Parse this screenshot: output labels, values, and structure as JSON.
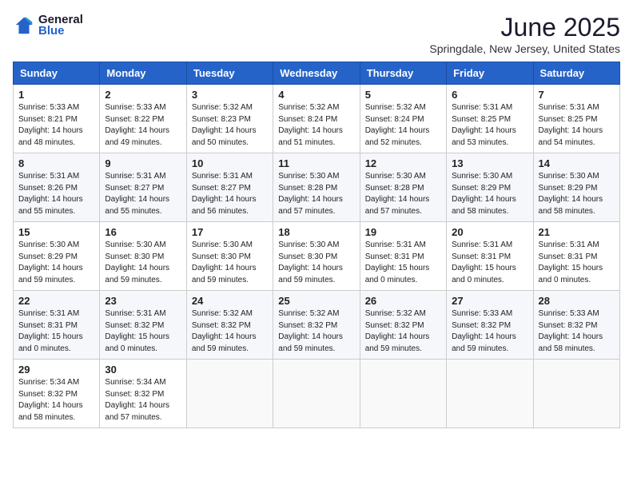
{
  "logo": {
    "general": "General",
    "blue": "Blue"
  },
  "title": "June 2025",
  "location": "Springdale, New Jersey, United States",
  "weekdays": [
    "Sunday",
    "Monday",
    "Tuesday",
    "Wednesday",
    "Thursday",
    "Friday",
    "Saturday"
  ],
  "weeks": [
    [
      {
        "day": "1",
        "info": "Sunrise: 5:33 AM\nSunset: 8:21 PM\nDaylight: 14 hours\nand 48 minutes."
      },
      {
        "day": "2",
        "info": "Sunrise: 5:33 AM\nSunset: 8:22 PM\nDaylight: 14 hours\nand 49 minutes."
      },
      {
        "day": "3",
        "info": "Sunrise: 5:32 AM\nSunset: 8:23 PM\nDaylight: 14 hours\nand 50 minutes."
      },
      {
        "day": "4",
        "info": "Sunrise: 5:32 AM\nSunset: 8:24 PM\nDaylight: 14 hours\nand 51 minutes."
      },
      {
        "day": "5",
        "info": "Sunrise: 5:32 AM\nSunset: 8:24 PM\nDaylight: 14 hours\nand 52 minutes."
      },
      {
        "day": "6",
        "info": "Sunrise: 5:31 AM\nSunset: 8:25 PM\nDaylight: 14 hours\nand 53 minutes."
      },
      {
        "day": "7",
        "info": "Sunrise: 5:31 AM\nSunset: 8:25 PM\nDaylight: 14 hours\nand 54 minutes."
      }
    ],
    [
      {
        "day": "8",
        "info": "Sunrise: 5:31 AM\nSunset: 8:26 PM\nDaylight: 14 hours\nand 55 minutes."
      },
      {
        "day": "9",
        "info": "Sunrise: 5:31 AM\nSunset: 8:27 PM\nDaylight: 14 hours\nand 55 minutes."
      },
      {
        "day": "10",
        "info": "Sunrise: 5:31 AM\nSunset: 8:27 PM\nDaylight: 14 hours\nand 56 minutes."
      },
      {
        "day": "11",
        "info": "Sunrise: 5:30 AM\nSunset: 8:28 PM\nDaylight: 14 hours\nand 57 minutes."
      },
      {
        "day": "12",
        "info": "Sunrise: 5:30 AM\nSunset: 8:28 PM\nDaylight: 14 hours\nand 57 minutes."
      },
      {
        "day": "13",
        "info": "Sunrise: 5:30 AM\nSunset: 8:29 PM\nDaylight: 14 hours\nand 58 minutes."
      },
      {
        "day": "14",
        "info": "Sunrise: 5:30 AM\nSunset: 8:29 PM\nDaylight: 14 hours\nand 58 minutes."
      }
    ],
    [
      {
        "day": "15",
        "info": "Sunrise: 5:30 AM\nSunset: 8:29 PM\nDaylight: 14 hours\nand 59 minutes."
      },
      {
        "day": "16",
        "info": "Sunrise: 5:30 AM\nSunset: 8:30 PM\nDaylight: 14 hours\nand 59 minutes."
      },
      {
        "day": "17",
        "info": "Sunrise: 5:30 AM\nSunset: 8:30 PM\nDaylight: 14 hours\nand 59 minutes."
      },
      {
        "day": "18",
        "info": "Sunrise: 5:30 AM\nSunset: 8:30 PM\nDaylight: 14 hours\nand 59 minutes."
      },
      {
        "day": "19",
        "info": "Sunrise: 5:31 AM\nSunset: 8:31 PM\nDaylight: 15 hours\nand 0 minutes."
      },
      {
        "day": "20",
        "info": "Sunrise: 5:31 AM\nSunset: 8:31 PM\nDaylight: 15 hours\nand 0 minutes."
      },
      {
        "day": "21",
        "info": "Sunrise: 5:31 AM\nSunset: 8:31 PM\nDaylight: 15 hours\nand 0 minutes."
      }
    ],
    [
      {
        "day": "22",
        "info": "Sunrise: 5:31 AM\nSunset: 8:31 PM\nDaylight: 15 hours\nand 0 minutes."
      },
      {
        "day": "23",
        "info": "Sunrise: 5:31 AM\nSunset: 8:32 PM\nDaylight: 15 hours\nand 0 minutes."
      },
      {
        "day": "24",
        "info": "Sunrise: 5:32 AM\nSunset: 8:32 PM\nDaylight: 14 hours\nand 59 minutes."
      },
      {
        "day": "25",
        "info": "Sunrise: 5:32 AM\nSunset: 8:32 PM\nDaylight: 14 hours\nand 59 minutes."
      },
      {
        "day": "26",
        "info": "Sunrise: 5:32 AM\nSunset: 8:32 PM\nDaylight: 14 hours\nand 59 minutes."
      },
      {
        "day": "27",
        "info": "Sunrise: 5:33 AM\nSunset: 8:32 PM\nDaylight: 14 hours\nand 59 minutes."
      },
      {
        "day": "28",
        "info": "Sunrise: 5:33 AM\nSunset: 8:32 PM\nDaylight: 14 hours\nand 58 minutes."
      }
    ],
    [
      {
        "day": "29",
        "info": "Sunrise: 5:34 AM\nSunset: 8:32 PM\nDaylight: 14 hours\nand 58 minutes."
      },
      {
        "day": "30",
        "info": "Sunrise: 5:34 AM\nSunset: 8:32 PM\nDaylight: 14 hours\nand 57 minutes."
      },
      null,
      null,
      null,
      null,
      null
    ]
  ]
}
